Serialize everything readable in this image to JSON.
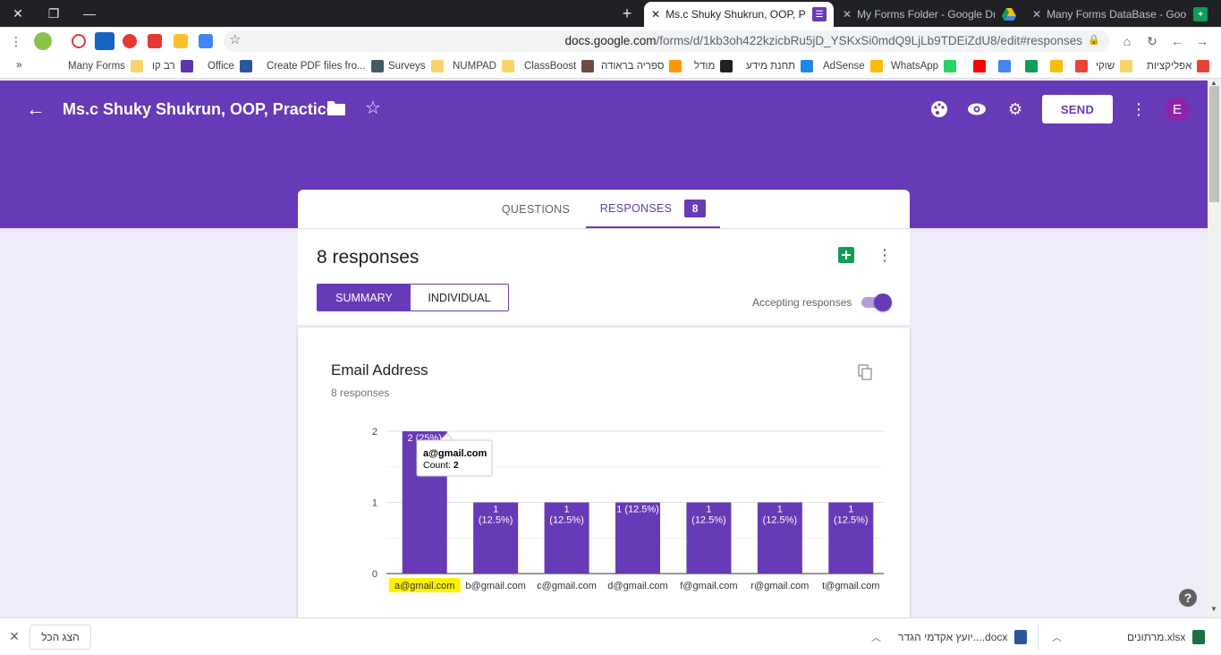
{
  "browser": {
    "tabs": [
      {
        "label": "Ms.c Shuky Shukrun, OOP, Practi",
        "active": true
      },
      {
        "label": "My Forms Folder - Google Drive",
        "active": false
      },
      {
        "label": "Many Forms DataBase - Google S",
        "active": false
      }
    ],
    "new_tab_symbol": "+",
    "url_main": "docs.google.com",
    "url_path": "/forms/d/1kb3oh422kzicbRu5jD_YSKxSi0mdQ9LjLb9TDEiZdU8/edit#responses",
    "bookmarks": [
      {
        "label": "אפליקציות",
        "icon": "apps-grid-icon"
      },
      {
        "label": "שוקי",
        "icon": "folder-icon"
      },
      {
        "label": "",
        "icon": "gmail-icon"
      },
      {
        "label": "",
        "icon": "photos-icon"
      },
      {
        "label": "",
        "icon": "drive-icon"
      },
      {
        "label": "",
        "icon": "translate-icon"
      },
      {
        "label": "",
        "icon": "youtube-icon"
      },
      {
        "label": "WhatsApp",
        "icon": "whatsapp-icon"
      },
      {
        "label": "AdSense",
        "icon": "adsense-icon"
      },
      {
        "label": "תחנת מידע",
        "icon": "on-icon"
      },
      {
        "label": "מודל",
        "icon": "moodle-icon"
      },
      {
        "label": "ספריה בראודה",
        "icon": "library-icon"
      },
      {
        "label": "ClassBoost",
        "icon": "classboost-icon"
      },
      {
        "label": "NUMPAD",
        "icon": "folder-icon"
      },
      {
        "label": "Surveys",
        "icon": "folder-icon"
      },
      {
        "label": "Create PDF files fro...",
        "icon": "pdf-icon"
      },
      {
        "label": "Office",
        "icon": "word-icon"
      },
      {
        "label": "רב קו",
        "icon": "ravkav-icon"
      },
      {
        "label": "Many Forms",
        "icon": "folder-icon"
      }
    ],
    "bookmarks_overflow": "»"
  },
  "form": {
    "title": "Ms.c Shuky Shukrun, OOP, Practice",
    "send_label": "SEND",
    "avatar_letter": "E",
    "tabs": {
      "questions": "QUESTIONS",
      "responses": "RESPONSES",
      "response_badge": "8"
    },
    "summary": {
      "count_label": "8 responses",
      "seg_summary": "SUMMARY",
      "seg_individual": "INDIVIDUAL",
      "accepting_label": "Accepting responses",
      "accepting": true
    },
    "question": {
      "title": "Email Address",
      "subtitle": "8 responses"
    },
    "tooltip": {
      "title": "a@gmail.com",
      "count_label": "Count:",
      "count_value": "2"
    }
  },
  "chart_data": {
    "type": "bar",
    "categories": [
      "a@gmail.com",
      "b@gmail.com",
      "c@gmail.com",
      "d@gmail.com",
      "f@gmail.com",
      "r@gmail.com",
      "t@gmail.com"
    ],
    "values": [
      2,
      1,
      1,
      1,
      1,
      1,
      1
    ],
    "data_labels": [
      "2 (25%)",
      "1\n(12.5%)",
      "1\n(12.5%)",
      "1 (12.5%)",
      "1\n(12.5%)",
      "1\n(12.5%)",
      "1\n(12.5%)"
    ],
    "yticks": [
      "0",
      "1",
      "2"
    ],
    "ylim": [
      0,
      2
    ],
    "grid": true,
    "bar_color": "#673ab7",
    "highlight_category": "a@gmail.com",
    "highlight_color": "#fff200"
  },
  "downloads": [
    {
      "label": "מרתונים.xlsx",
      "icon": "excel-icon"
    },
    {
      "label": "יועץ אקדמי הגדר....docx",
      "icon": "word-icon"
    }
  ],
  "downloads_show_all": "הצג הכל",
  "colors": {
    "brand": "#673ab7",
    "background": "#f0ebf8"
  }
}
